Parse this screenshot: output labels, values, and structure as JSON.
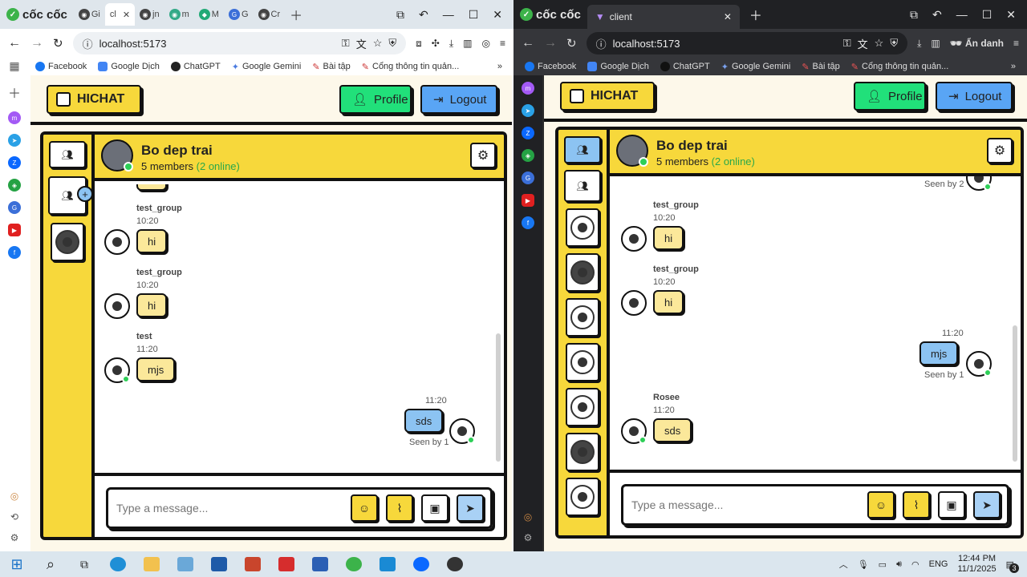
{
  "left_browser": {
    "brand": "cốc cốc",
    "tabs": [
      {
        "label": "Gi",
        "icon": "github-icon"
      },
      {
        "label": "cl",
        "icon": "vite-icon",
        "active": true
      },
      {
        "label": "jn",
        "icon": "github-icon"
      },
      {
        "label": "m",
        "icon": "github-icon"
      },
      {
        "label": "M",
        "icon": "mongodb-icon"
      },
      {
        "label": "G",
        "icon": "translate-icon"
      },
      {
        "label": "Cr",
        "icon": "github-icon"
      }
    ],
    "url": "localhost:5173",
    "bookmarks": [
      "Facebook",
      "Google Dịch",
      "ChatGPT",
      "Google Gemini",
      "Bài tập",
      "Cổng thông tin quản..."
    ],
    "bookmark_more": "»"
  },
  "right_browser": {
    "brand": "cốc cốc",
    "tab_title": "client",
    "url": "localhost:5173",
    "incognito_label": "Ẩn danh",
    "bookmarks": [
      "Facebook",
      "Google Dịch",
      "ChatGPT",
      "Google Gemini",
      "Bài tập",
      "Cổng thông tin quản..."
    ],
    "bookmark_more": "»"
  },
  "app": {
    "brand": "HICHAT",
    "profile_label": "Profile",
    "logout_label": "Logout",
    "group_name": "Bo dep trai",
    "members_text": "5 members",
    "online_text": "(2 online)",
    "input_placeholder": "Type a message...",
    "colors": {
      "yellow": "#f7d83b",
      "blue": "#8cc3f2",
      "green": "#21e07a",
      "cream": "#fdf8ea"
    }
  },
  "left_chat": {
    "messages": [
      {
        "sender": "test_group",
        "time": "10:20",
        "text": "hi"
      },
      {
        "sender": "test_group",
        "time": "10:20",
        "text": "hi"
      },
      {
        "sender": "test",
        "time": "11:20",
        "text": "mjs"
      }
    ],
    "own_message": {
      "time": "11:20",
      "text": "sds",
      "seen": "Seen by 1"
    }
  },
  "right_chat": {
    "top_seen": "Seen by 2",
    "messages": [
      {
        "sender": "test_group",
        "time": "10:20",
        "text": "hi"
      },
      {
        "sender": "test_group",
        "time": "10:20",
        "text": "hi"
      }
    ],
    "own_message": {
      "time": "11:20",
      "text": "mjs",
      "seen": "Seen by 1"
    },
    "last_message": {
      "sender": "Rosee",
      "time": "11:20",
      "text": "sds"
    }
  },
  "taskbar": {
    "lang": "ENG",
    "time": "12:44 PM",
    "date": "11/1/2025",
    "notif_count": "3"
  }
}
